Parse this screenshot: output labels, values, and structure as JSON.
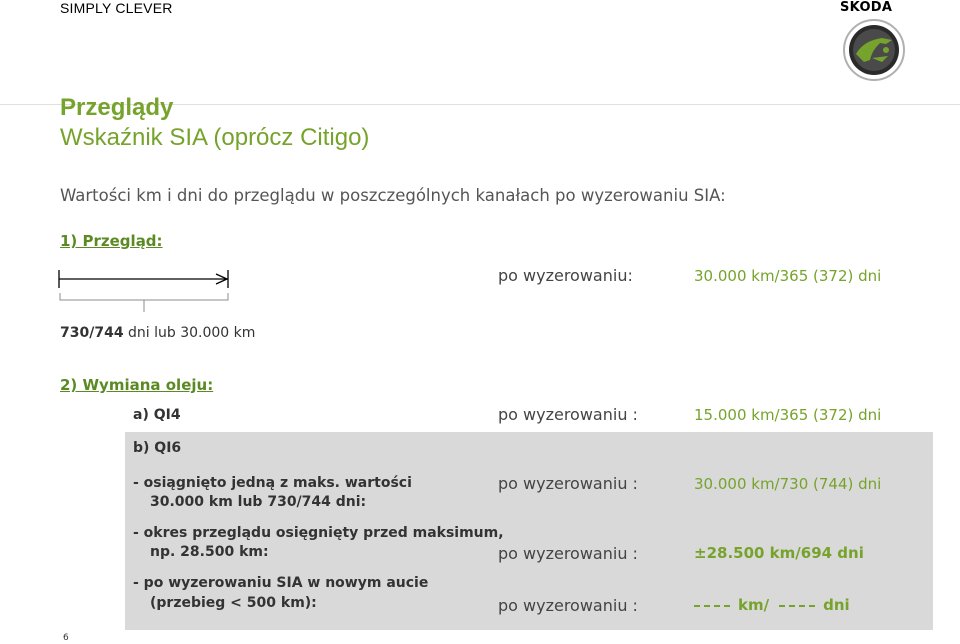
{
  "header": {
    "slogan": "SIMPLY CLEVER",
    "brand": "ŠKODA"
  },
  "title": {
    "line1": "Przeglądy",
    "line2": "Wskaźnik SIA (oprócz Citigo)"
  },
  "intro": "Wartości km i dni do przeglądu w poszczególnych kanałach po wyzerowaniu SIA:",
  "section1": {
    "heading": "1) Przegląd:",
    "label": "po wyzerowaniu:",
    "value": "30.000 km/365 (372) dni",
    "legend_bold": "730/744",
    "legend_rest": " dni lub 30.000 km"
  },
  "section2": {
    "heading": "2) Wymiana oleju:",
    "a_label": "a) QI4",
    "a_reset": "po wyzerowaniu :",
    "a_value": "15.000 km/365 (372) dni",
    "b_label": "b) QI6",
    "b1_line1": "- osiągnięto jedną z maks. wartości",
    "b1_line2": "30.000 km lub 730/744 dni:",
    "b1_reset": "po wyzerowaniu :",
    "b1_value": "30.000 km/730 (744) dni",
    "b2_line1": "- okres przeglądu osięgnięty przed maksimum,",
    "b2_line2": "np. 28.500 km:",
    "b2_reset": "po wyzerowaniu :",
    "b2_value": "±28.500 km/694 dni",
    "b3_line1": "- po wyzerowaniu SIA w nowym aucie",
    "b3_line2": "(przebieg < 500 km):",
    "b3_reset": "po wyzerowaniu :",
    "b3_value_km": "km/",
    "b3_value_days": "dni"
  },
  "page_number": "6",
  "colors": {
    "accent": "#76a32c",
    "panel": "#d9d9d9"
  }
}
